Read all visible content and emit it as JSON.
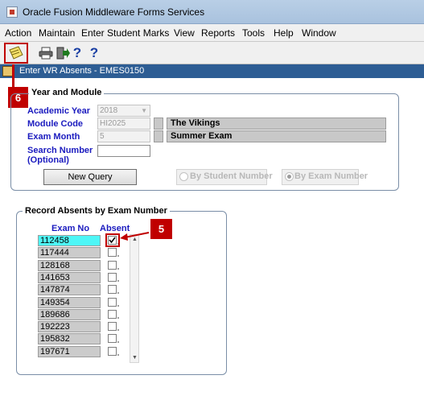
{
  "window": {
    "title": "Oracle Fusion Middleware Forms Services"
  },
  "menu": [
    "Action",
    "Maintain",
    "Enter Student Marks",
    "View",
    "Reports",
    "Tools",
    "Help",
    "Window"
  ],
  "toolbar": {
    "help1": "?",
    "help2": "?"
  },
  "form": {
    "title": "Enter WR Absents - EMES0150"
  },
  "callouts": {
    "six": "6",
    "five": "5"
  },
  "year_module": {
    "legend": "Year and Module",
    "academic_year_label": "Academic Year",
    "academic_year_value": "2018",
    "module_code_label": "Module Code",
    "module_code_value": "HI2025",
    "module_name": "The Vikings",
    "exam_month_label": "Exam Month",
    "exam_month_value": "5",
    "exam_month_name": "Summer Exam",
    "search_number_label": "Search Number",
    "search_number_optional": "(Optional)",
    "search_number_value": "",
    "new_query_button": "New Query",
    "radio_student": "By Student Number",
    "radio_exam": "By Exam Number"
  },
  "absents": {
    "legend": "Record Absents by Exam Number",
    "col_exam_no": "Exam No",
    "col_absent": "Absent",
    "rows": [
      {
        "exam_no": "112458",
        "absent": true
      },
      {
        "exam_no": "117444",
        "absent": false
      },
      {
        "exam_no": "128168",
        "absent": false
      },
      {
        "exam_no": "141653",
        "absent": false
      },
      {
        "exam_no": "147874",
        "absent": false
      },
      {
        "exam_no": "149354",
        "absent": false
      },
      {
        "exam_no": "189686",
        "absent": false
      },
      {
        "exam_no": "192223",
        "absent": false
      },
      {
        "exam_no": "195832",
        "absent": false
      },
      {
        "exam_no": "197671",
        "absent": false
      }
    ]
  },
  "colors": {
    "accent_red": "#c00000",
    "form_bar": "#2d5d94",
    "label_blue": "#1b1bbf",
    "selected_row": "#4df6f6"
  }
}
